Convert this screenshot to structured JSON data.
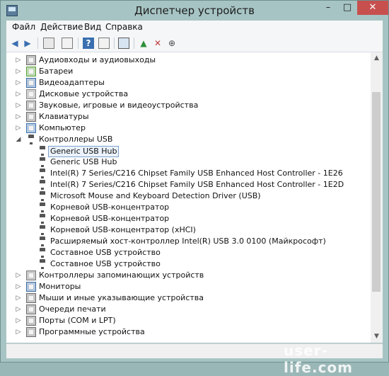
{
  "window": {
    "title": "Диспетчер устройств",
    "min": "–",
    "max": "□",
    "close": "✕"
  },
  "menu": [
    "Файл",
    "Действие",
    "Вид",
    "Справка"
  ],
  "toolbar": [
    "back-icon",
    "forward-icon",
    "properties-icon",
    "view-icon",
    "help-icon",
    "details-icon",
    "scan-hardware-icon",
    "update-driver-icon",
    "disable-device-icon",
    "uninstall-device-icon"
  ],
  "tree": [
    {
      "label": "Аудиовходы и аудиовыходы",
      "level": 0,
      "expander": "▷",
      "icon": "audio-icon",
      "color": "#6a6a6a"
    },
    {
      "label": "Батареи",
      "level": 0,
      "expander": "▷",
      "icon": "battery-icon",
      "color": "#5aa43a"
    },
    {
      "label": "Видеоадаптеры",
      "level": 0,
      "expander": "▷",
      "icon": "display-adapter-icon",
      "color": "#3c6da8"
    },
    {
      "label": "Дисковые устройства",
      "level": 0,
      "expander": "▷",
      "icon": "disk-drive-icon",
      "color": "#8a8a8a"
    },
    {
      "label": "Звуковые, игровые и видеоустройства",
      "level": 0,
      "expander": "▷",
      "icon": "sound-icon",
      "color": "#707070"
    },
    {
      "label": "Клавиатуры",
      "level": 0,
      "expander": "▷",
      "icon": "keyboard-icon",
      "color": "#6b6b6b"
    },
    {
      "label": "Компьютер",
      "level": 0,
      "expander": "▷",
      "icon": "computer-icon",
      "color": "#3d76b5"
    },
    {
      "label": "Контроллеры USB",
      "level": 0,
      "expander": "◢",
      "icon": "usb-icon",
      "color": "#555555"
    },
    {
      "label": "Generic USB Hub",
      "level": 1,
      "expander": "",
      "icon": "usb-icon",
      "color": "#555555",
      "selected": true
    },
    {
      "label": "Generic USB Hub",
      "level": 1,
      "expander": "",
      "icon": "usb-icon",
      "color": "#555555"
    },
    {
      "label": "Intel(R) 7 Series/C216 Chipset Family USB Enhanced Host Controller - 1E26",
      "level": 1,
      "expander": "",
      "icon": "usb-icon",
      "color": "#555555"
    },
    {
      "label": "Intel(R) 7 Series/C216 Chipset Family USB Enhanced Host Controller - 1E2D",
      "level": 1,
      "expander": "",
      "icon": "usb-icon",
      "color": "#555555"
    },
    {
      "label": "Microsoft Mouse and Keyboard Detection Driver (USB)",
      "level": 1,
      "expander": "",
      "icon": "usb-icon",
      "color": "#555555"
    },
    {
      "label": "Корневой USB-концентратор",
      "level": 1,
      "expander": "",
      "icon": "usb-icon",
      "color": "#555555"
    },
    {
      "label": "Корневой USB-концентратор",
      "level": 1,
      "expander": "",
      "icon": "usb-icon",
      "color": "#555555"
    },
    {
      "label": "Корневой USB-концентратор (xHCI)",
      "level": 1,
      "expander": "",
      "icon": "usb-icon",
      "color": "#555555"
    },
    {
      "label": "Расширяемый хост-контроллер Intel(R) USB 3.0 0100 (Майкрософт)",
      "level": 1,
      "expander": "",
      "icon": "usb-icon",
      "color": "#555555"
    },
    {
      "label": "Составное USB устройство",
      "level": 1,
      "expander": "",
      "icon": "usb-icon",
      "color": "#555555"
    },
    {
      "label": "Составное USB устройство",
      "level": 1,
      "expander": "",
      "icon": "usb-icon",
      "color": "#555555"
    },
    {
      "label": "Контроллеры запоминающих устройств",
      "level": 0,
      "expander": "▷",
      "icon": "storage-controller-icon",
      "color": "#7a7a7a"
    },
    {
      "label": "Мониторы",
      "level": 0,
      "expander": "▷",
      "icon": "monitor-icon",
      "color": "#3c6da8"
    },
    {
      "label": "Мыши и иные указывающие устройства",
      "level": 0,
      "expander": "▷",
      "icon": "mouse-icon",
      "color": "#6b6b6b"
    },
    {
      "label": "Очереди печати",
      "level": 0,
      "expander": "▷",
      "icon": "printer-icon",
      "color": "#6b6b6b"
    },
    {
      "label": "Порты (COM и LPT)",
      "level": 0,
      "expander": "▷",
      "icon": "port-icon",
      "color": "#6b6b6b"
    },
    {
      "label": "Программные устройства",
      "level": 0,
      "expander": "▷",
      "icon": "software-device-icon",
      "color": "#6b6b6b"
    }
  ],
  "watermark": "user-life.com"
}
